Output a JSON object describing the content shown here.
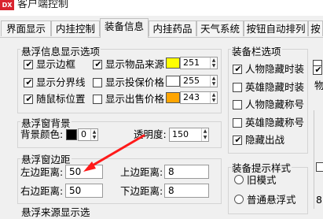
{
  "window": {
    "title": "客户端控制",
    "icon_text": "DX"
  },
  "tabs": [
    {
      "label": "界面显示",
      "active": false
    },
    {
      "label": "内挂控制",
      "active": false
    },
    {
      "label": "装备信息",
      "active": true
    },
    {
      "label": "内挂药品",
      "active": false
    },
    {
      "label": "天气系统",
      "active": false
    },
    {
      "label": "按钮自动排列",
      "active": false
    },
    {
      "label": "按",
      "active": false
    }
  ],
  "float_display": {
    "title": "悬浮信息显示选项",
    "show_border": {
      "label": "显示边框",
      "checked": true
    },
    "show_item_source": {
      "label": "显示物品来源",
      "checked": true,
      "color": "#ffff00",
      "value": "251"
    },
    "show_separator": {
      "label": "显示分界线",
      "checked": true
    },
    "show_delivery_price": {
      "label": "显示投保价格",
      "checked": false,
      "color": "#ffffff",
      "value": "255"
    },
    "follow_mouse": {
      "label": "随鼠标位置",
      "checked": true
    },
    "show_sell_price": {
      "label": "显示出售价格",
      "checked": false,
      "color": "#ffa500",
      "value": "243"
    }
  },
  "float_bg": {
    "title": "悬浮窗背景",
    "bg_color_label": "背景颜色:",
    "bg_color": "#000000",
    "bg_color_value": "0",
    "opacity_label": "透明度:",
    "opacity_value": "150"
  },
  "float_margin": {
    "title": "悬浮窗边距",
    "left_label": "左边距离:",
    "left_value": "50",
    "top_label": "上边距离:",
    "top_value": "8",
    "right_label": "右边距离:",
    "right_value": "50",
    "bottom_label": "下边距离:",
    "bottom_value": "8",
    "next_title": "悬浮来源显示选"
  },
  "equip_bar": {
    "title": "装备栏选项",
    "items": [
      {
        "label": "人物隐藏时装",
        "checked": true
      },
      {
        "label": "英雄隐藏时装",
        "checked": false
      },
      {
        "label": "人物隐藏称号",
        "checked": false
      },
      {
        "label": "英雄隐藏称号",
        "checked": false
      },
      {
        "label": "隐藏出战",
        "checked": true
      }
    ]
  },
  "equip_tip": {
    "title": "装备提示样式",
    "options": [
      {
        "label": "旧模式",
        "selected": false
      },
      {
        "label": "普通悬浮式",
        "selected": false
      }
    ]
  },
  "right_partial": {
    "text1": "物",
    "text2": "8"
  }
}
